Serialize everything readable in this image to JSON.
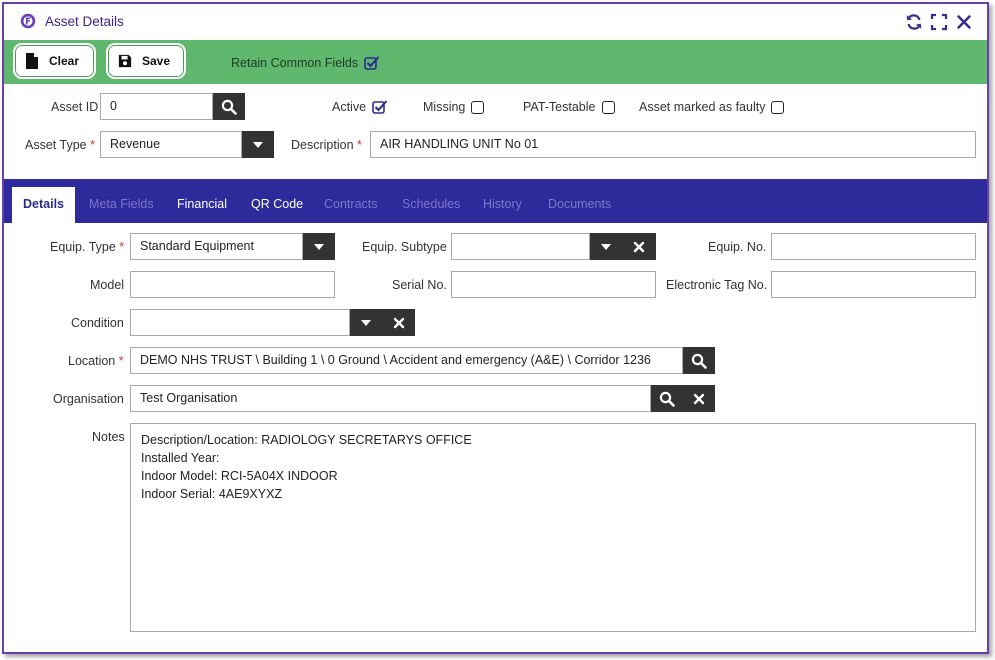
{
  "window": {
    "title": "Asset Details",
    "icons": [
      "app-logo-icon",
      "refresh-icon",
      "expand-icon",
      "close-icon"
    ]
  },
  "toolbar": {
    "clear_label": "Clear",
    "save_label": "Save",
    "retain_label": "Retain Common Fields",
    "retain_checked": true
  },
  "header": {
    "asset_id_label": "Asset ID",
    "asset_id_value": "0",
    "active_label": "Active",
    "active_checked": true,
    "missing_label": "Missing",
    "missing_checked": false,
    "pat_label": "PAT-Testable",
    "pat_checked": false,
    "faulty_label": "Asset marked as faulty",
    "faulty_checked": false,
    "asset_type_label": "Asset Type",
    "asset_type_value": "Revenue",
    "description_label": "Description",
    "description_value": "AIR HANDLING UNIT No 01",
    "required_mark": "*"
  },
  "tabs": [
    {
      "label": "Details",
      "state": "active"
    },
    {
      "label": "Meta Fields",
      "state": "disabled"
    },
    {
      "label": "Financial",
      "state": "enabled"
    },
    {
      "label": "QR Code",
      "state": "enabled"
    },
    {
      "label": "Contracts",
      "state": "disabled"
    },
    {
      "label": "Schedules",
      "state": "disabled"
    },
    {
      "label": "History",
      "state": "disabled"
    },
    {
      "label": "Documents",
      "state": "disabled"
    }
  ],
  "details": {
    "equip_type_label": "Equip. Type",
    "equip_type_value": "Standard Equipment",
    "equip_subtype_label": "Equip. Subtype",
    "equip_subtype_value": "",
    "equip_no_label": "Equip. No.",
    "equip_no_value": "",
    "model_label": "Model",
    "model_value": "",
    "serial_label": "Serial No.",
    "serial_value": "",
    "etag_label": "Electronic Tag No.",
    "etag_value": "",
    "condition_label": "Condition",
    "condition_value": "",
    "location_label": "Location",
    "location_value": "DEMO NHS TRUST \\ Building 1 \\ 0 Ground \\ Accident and emergency (A&E) \\ Corridor 1236",
    "organisation_label": "Organisation",
    "organisation_value": "Test Organisation",
    "notes_label": "Notes",
    "notes_lines": [
      "Description/Location: RADIOLOGY SECRETARYS OFFICE",
      "Installed Year:",
      "Indoor Model: RCI-5A04X  INDOOR",
      "Indoor Serial: 4AE9XYXZ"
    ]
  },
  "colors": {
    "toolbar_green": "#5fb86e",
    "tabbar_navy": "#2d2a9b",
    "window_border": "#6a3db0",
    "accent_check": "#2b2890",
    "required_red": "#d43333"
  }
}
